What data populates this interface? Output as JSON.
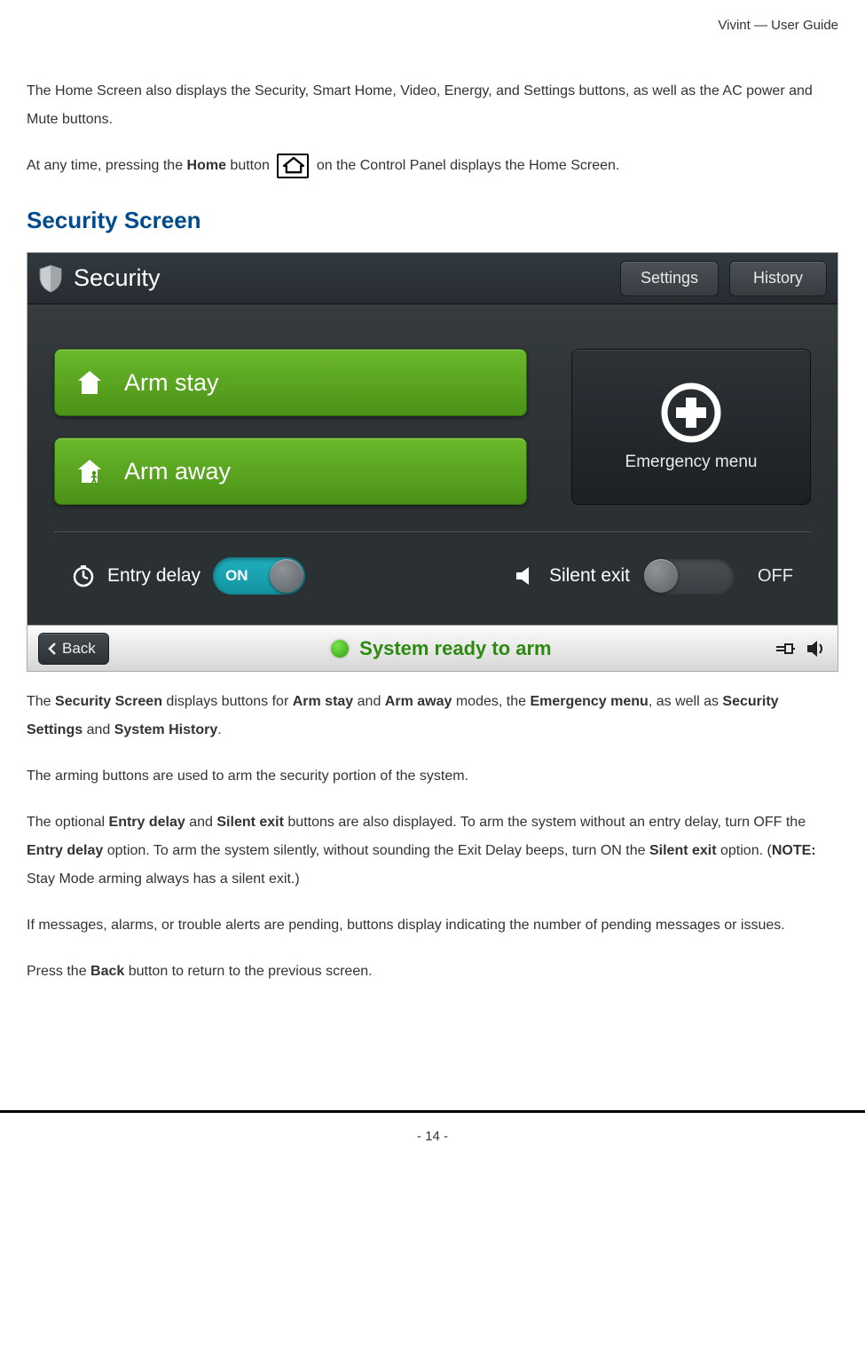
{
  "header": {
    "doc_title": "Vivint — User Guide"
  },
  "intro": {
    "p1": "The Home Screen also displays the Security, Smart Home, Video, Energy, and Settings buttons, as well as the AC power and Mute buttons.",
    "p2_a": "At any time, pressing the ",
    "p2_b_bold": "Home",
    "p2_c": " button ",
    "p2_d": " on the Control Panel displays the Home Screen."
  },
  "section": {
    "title": "Security Screen"
  },
  "ss": {
    "title": "Security",
    "settings_label": "Settings",
    "history_label": "History",
    "arm_stay_label": "Arm stay",
    "arm_away_label": "Arm away",
    "emergency_label": "Emergency menu",
    "entry_delay_label": "Entry delay",
    "entry_delay_state": "ON",
    "silent_exit_label": "Silent exit",
    "silent_exit_state": "OFF",
    "back_label": "Back",
    "status_text": "System ready to arm"
  },
  "body": {
    "p1_a": "The ",
    "p1_b": "Security Screen",
    "p1_c": " displays buttons for ",
    "p1_d": "Arm stay",
    "p1_e": " and ",
    "p1_f": "Arm away",
    "p1_g": " modes, the ",
    "p1_h": "Emergency menu",
    "p1_i": ", as well as ",
    "p1_j": "Security Settings",
    "p1_k": " and ",
    "p1_l": "System History",
    "p1_m": ".",
    "p2": "The arming buttons are used to arm the security portion of the system.",
    "p3_a": "The optional ",
    "p3_b": "Entry delay",
    "p3_c": " and ",
    "p3_d": "Silent exit",
    "p3_e": " buttons are also displayed. To arm the system without an entry delay, turn OFF the ",
    "p3_f": "Entry delay",
    "p3_g": " option. To arm the system silently, without sounding the Exit Delay beeps, turn ON the ",
    "p3_h": "Silent exit",
    "p3_i": " option. (",
    "p3_j": "NOTE:",
    "p3_k": " Stay Mode arming always has a silent exit.)",
    "p4": "If messages, alarms, or trouble alerts are pending, buttons display indicating the number of pending messages or issues.",
    "p5_a": "Press the ",
    "p5_b": "Back",
    "p5_c": " button to return to the previous screen."
  },
  "footer": {
    "page_num": "- 14 -"
  }
}
